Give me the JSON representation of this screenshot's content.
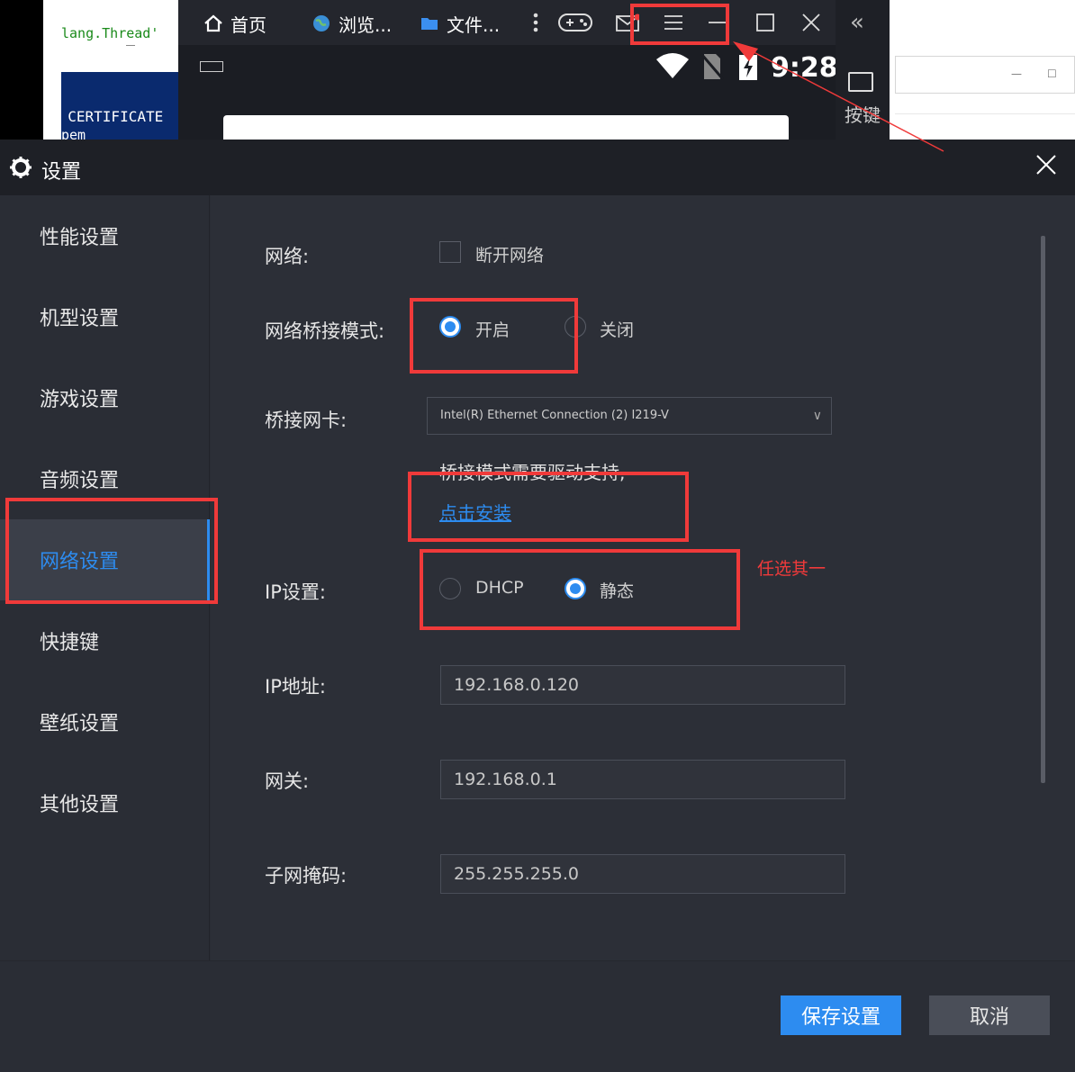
{
  "background": {
    "code_line": "lang.Thread'",
    "code_cert": "D CERTIFICATE",
    "code_pem": "pem"
  },
  "emulator": {
    "tabs": [
      {
        "label": "首页",
        "icon": "home-icon"
      },
      {
        "label": "浏览...",
        "icon": "globe-icon"
      },
      {
        "label": "文件...",
        "icon": "folder-icon"
      }
    ],
    "status_time": "9:28",
    "side_label": "按键",
    "colors": {
      "bar": "#24262d",
      "body": "#1b1d23"
    }
  },
  "dialog": {
    "title": "设置",
    "sidebar": [
      {
        "label": "性能设置"
      },
      {
        "label": "机型设置"
      },
      {
        "label": "游戏设置"
      },
      {
        "label": "音频设置"
      },
      {
        "label": "网络设置",
        "active": true
      },
      {
        "label": "快捷键"
      },
      {
        "label": "壁纸设置"
      },
      {
        "label": "其他设置"
      }
    ],
    "network": {
      "label": "网络:",
      "disconnect_option": "断开网络",
      "disconnect_checked": false
    },
    "bridge_mode": {
      "label": "网络桥接模式:",
      "on_label": "开启",
      "off_label": "关闭",
      "selected": "开启"
    },
    "bridge_nic": {
      "label": "桥接网卡:",
      "value": "Intel(R) Ethernet Connection (2) I219-V",
      "note": "桥接模式需要驱动支持,",
      "install_link": "点击安装"
    },
    "ip_setting": {
      "label": "IP设置:",
      "dhcp_label": "DHCP",
      "static_label": "静态",
      "selected": "静态"
    },
    "ip_address": {
      "label": "IP地址:",
      "value": "192.168.0.120"
    },
    "gateway": {
      "label": "网关:",
      "value": "192.168.0.1"
    },
    "subnet_mask": {
      "label": "子网掩码:",
      "value": "255.255.255.0"
    },
    "save_button": "保存设置",
    "cancel_button": "取消",
    "colors": {
      "accent": "#2d8cf0",
      "bg": "#2a2d35",
      "header": "#1e2026"
    }
  },
  "annotations": {
    "choose_one": "任选其一",
    "color": "#f03a3a"
  }
}
